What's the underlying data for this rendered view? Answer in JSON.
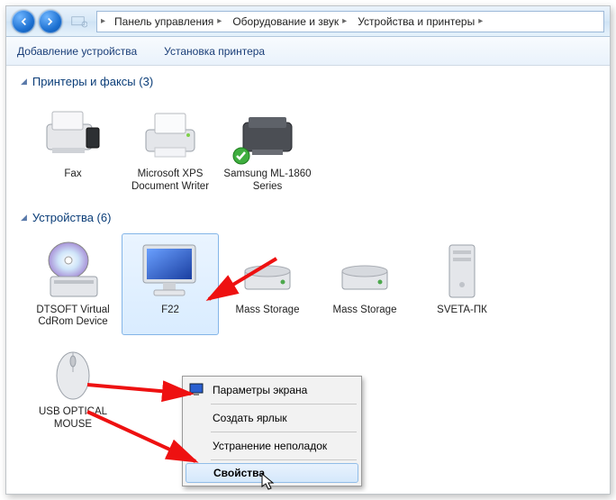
{
  "breadcrumb": {
    "segments": [
      "Панель управления",
      "Оборудование и звук",
      "Устройства и принтеры"
    ]
  },
  "toolbar": {
    "add_device": "Добавление устройства",
    "add_printer": "Установка принтера"
  },
  "sections": {
    "printers": {
      "title": "Принтеры и факсы",
      "count": "3"
    },
    "devices": {
      "title": "Устройства",
      "count": "6"
    }
  },
  "printers": [
    {
      "label": "Fax"
    },
    {
      "label": "Microsoft XPS Document Writer"
    },
    {
      "label": "Samsung ML-1860 Series",
      "default": true
    }
  ],
  "devices": [
    {
      "label": "DTSOFT Virtual CdRom Device"
    },
    {
      "label": "F22",
      "selected": true
    },
    {
      "label": "Mass Storage"
    },
    {
      "label": "Mass Storage"
    },
    {
      "label": "SVETA-ПК"
    },
    {
      "label": "USB OPTICAL MOUSE"
    }
  ],
  "contextmenu": {
    "display_settings": "Параметры экрана",
    "create_shortcut": "Создать ярлык",
    "troubleshoot": "Устранение неполадок",
    "properties": "Свойства"
  }
}
